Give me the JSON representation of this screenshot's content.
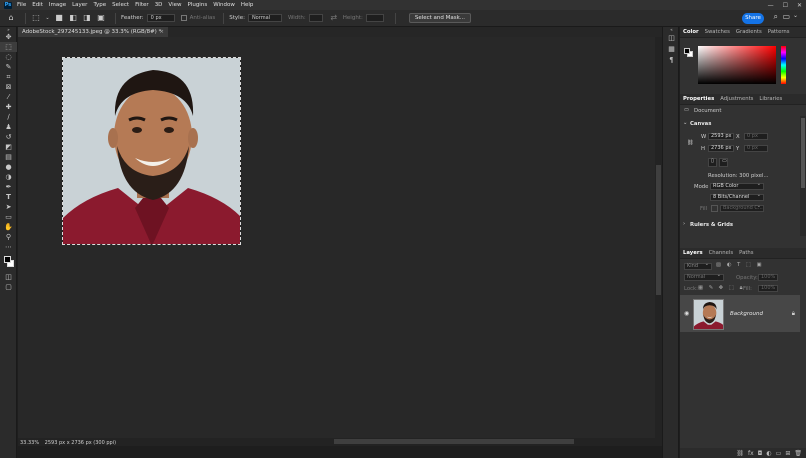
{
  "menu": [
    "File",
    "Edit",
    "Image",
    "Layer",
    "Type",
    "Select",
    "Filter",
    "3D",
    "View",
    "Plugins",
    "Window",
    "Help"
  ],
  "window_controls": [
    "—",
    "☐",
    "✕"
  ],
  "options": {
    "feather_label": "Feather:",
    "feather_value": "0 px",
    "antialias_label": "Anti-alias",
    "style_label": "Style:",
    "style_value": "Normal",
    "width_label": "Width:",
    "height_label": "Height:",
    "select_and_mask": "Select and Mask...",
    "share": "Share"
  },
  "document_tab": {
    "title": "AdobeStock_297245133.jpeg @ 33.3% (RGB/8#) *",
    "close": "×"
  },
  "status": {
    "zoom": "33.33%",
    "size": "2593 px x 2736 px (300 ppi)"
  },
  "color_panel": {
    "tabs": [
      "Color",
      "Swatches",
      "Gradients",
      "Patterns"
    ],
    "active_tab": "Color"
  },
  "properties_panel": {
    "tabs": [
      "Properties",
      "Adjustments",
      "Libraries"
    ],
    "document_label": "Document",
    "canvas_section": "Canvas",
    "w_label": "W",
    "w_value": "2593 px",
    "x_label": "X",
    "x_value": "0 px",
    "h_label": "H",
    "h_value": "2736 px",
    "y_label": "Y",
    "y_value": "0 px",
    "resolution": "Resolution: 300 pixel...",
    "mode_label": "Mode",
    "mode_value": "RGB Color",
    "bits_value": "8 Bits/Channel",
    "fill_label": "Fill",
    "fill_value": "Background C...",
    "rulers_section": "Rulers & Grids"
  },
  "layers_panel": {
    "tabs": [
      "Layers",
      "Channels",
      "Paths"
    ],
    "kind_label": "Kind",
    "blend_value": "Normal",
    "opacity_label": "Opacity:",
    "opacity_value": "100%",
    "lock_label": "Lock:",
    "fill_label": "Fill:",
    "fill_value": "100%",
    "layer_name": "Background"
  },
  "colors": {
    "accent": "#1473e6",
    "canvas": "#282828",
    "panel": "#323232",
    "shirt": "#8b1a2e",
    "photo_bg": "#c9d2d6"
  }
}
